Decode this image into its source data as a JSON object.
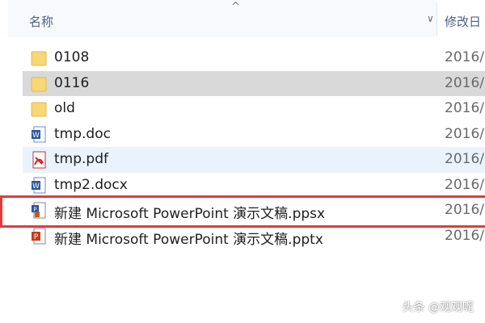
{
  "header": {
    "name_label": "名称",
    "date_label": "修改日",
    "sort_up_glyph": "^",
    "sort_down_glyph": "∨"
  },
  "files": [
    {
      "name": "0108",
      "date": "2016/",
      "icon": "folder-icon",
      "state": "normal"
    },
    {
      "name": "0116",
      "date": "2016/",
      "icon": "folder-icon",
      "state": "selected"
    },
    {
      "name": "old",
      "date": "2016/",
      "icon": "folder-icon",
      "state": "normal"
    },
    {
      "name": "tmp.doc",
      "date": "2016/",
      "icon": "word-doc-icon",
      "state": "normal"
    },
    {
      "name": "tmp.pdf",
      "date": "2016/",
      "icon": "pdf-icon",
      "state": "hover"
    },
    {
      "name": "tmp2.docx",
      "date": "2016/",
      "icon": "word-doc-icon",
      "state": "normal"
    },
    {
      "name": "新建 Microsoft PowerPoint 演示文稿.ppsx",
      "date": "2016/",
      "icon": "ppsx-icon",
      "state": "highlighted"
    },
    {
      "name": "新建 Microsoft PowerPoint 演示文稿.pptx",
      "date": "2016/",
      "icon": "pptx-icon",
      "state": "normal"
    }
  ],
  "highlight_color": "#e23b3b",
  "watermark": "头条 @观观呢"
}
